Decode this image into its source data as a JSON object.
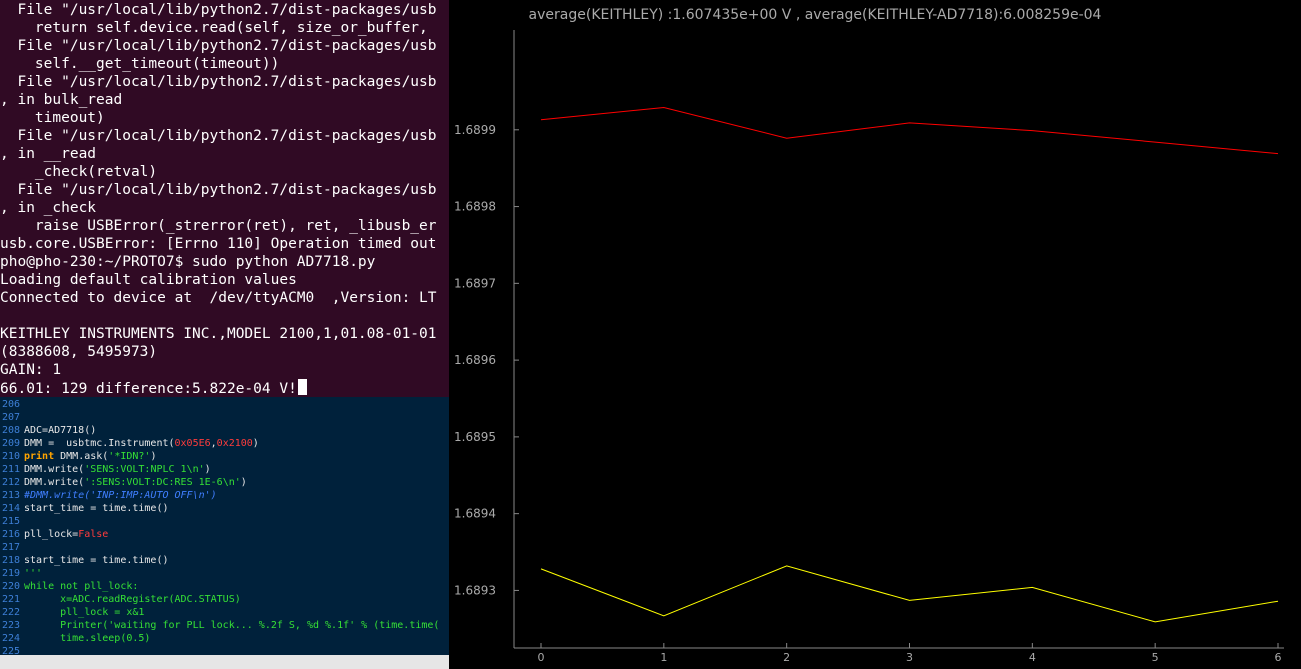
{
  "terminal": {
    "lines": [
      "  File \"/usr/local/lib/python2.7/dist-packages/usb",
      "    return self.device.read(self, size_or_buffer, ",
      "  File \"/usr/local/lib/python2.7/dist-packages/usb",
      "    self.__get_timeout(timeout))",
      "  File \"/usr/local/lib/python2.7/dist-packages/usb",
      ", in bulk_read",
      "    timeout)",
      "  File \"/usr/local/lib/python2.7/dist-packages/usb",
      ", in __read",
      "    _check(retval)",
      "  File \"/usr/local/lib/python2.7/dist-packages/usb",
      ", in _check",
      "    raise USBError(_strerror(ret), ret, _libusb_er",
      "usb.core.USBError: [Errno 110] Operation timed out",
      "pho@pho-230:~/PROTO7$ sudo python AD7718.py",
      "Loading default calibration values",
      "Connected to device at  /dev/ttyACM0  ,Version: LT",
      "",
      "KEITHLEY INSTRUMENTS INC.,MODEL 2100,1,01.08-01-01",
      "(8388608, 5495973)",
      "GAIN: 1",
      "66.01: 129 difference:5.822e-04 V!"
    ]
  },
  "editor": {
    "rows": [
      {
        "n": "206",
        "s": []
      },
      {
        "n": "207",
        "s": []
      },
      {
        "n": "208",
        "s": [
          {
            "t": "ADC=AD7718()",
            "c": ""
          }
        ]
      },
      {
        "n": "209",
        "s": [
          {
            "t": "DMM =  usbtmc.Instrument(",
            "c": ""
          },
          {
            "t": "0x05E6",
            "c": "num"
          },
          {
            "t": ",",
            "c": ""
          },
          {
            "t": "0x2100",
            "c": "num"
          },
          {
            "t": ")",
            "c": ""
          }
        ]
      },
      {
        "n": "210",
        "s": [
          {
            "t": "print",
            "c": "kw"
          },
          {
            "t": " DMM.ask(",
            "c": ""
          },
          {
            "t": "'*IDN?'",
            "c": "str"
          },
          {
            "t": ")",
            "c": ""
          }
        ]
      },
      {
        "n": "211",
        "s": [
          {
            "t": "DMM.write(",
            "c": ""
          },
          {
            "t": "'SENS:VOLT:NPLC 1\\n'",
            "c": "str"
          },
          {
            "t": ")",
            "c": ""
          }
        ]
      },
      {
        "n": "212",
        "s": [
          {
            "t": "DMM.write(",
            "c": ""
          },
          {
            "t": "':SENS:VOLT:DC:RES 1E-6\\n'",
            "c": "str"
          },
          {
            "t": ")",
            "c": ""
          }
        ]
      },
      {
        "n": "213",
        "s": [
          {
            "t": "#DMM.write('INP:IMP:AUTO OFF\\n')",
            "c": "cm"
          }
        ]
      },
      {
        "n": "214",
        "s": [
          {
            "t": "start_time = time.time()",
            "c": ""
          }
        ]
      },
      {
        "n": "215",
        "s": []
      },
      {
        "n": "216",
        "s": [
          {
            "t": "pll_lock=",
            "c": ""
          },
          {
            "t": "False",
            "c": "num"
          }
        ]
      },
      {
        "n": "217",
        "s": []
      },
      {
        "n": "218",
        "s": [
          {
            "t": "start_time = time.time()",
            "c": ""
          }
        ]
      },
      {
        "n": "219",
        "s": [
          {
            "t": "'''",
            "c": "grn"
          }
        ]
      },
      {
        "n": "220",
        "s": [
          {
            "t": "while not pll_lock:",
            "c": "grn"
          }
        ]
      },
      {
        "n": "221",
        "s": [
          {
            "t": "      x=ADC.readRegister(ADC.STATUS)",
            "c": "grn"
          }
        ]
      },
      {
        "n": "222",
        "s": [
          {
            "t": "      pll_lock = x&1",
            "c": "grn"
          }
        ]
      },
      {
        "n": "223",
        "s": [
          {
            "t": "      Printer('waiting for PLL lock... %.2f S, %d %.1f' % (time.time(",
            "c": "grn"
          }
        ]
      },
      {
        "n": "224",
        "s": [
          {
            "t": "      time.sleep(0.5)",
            "c": "grn"
          }
        ]
      },
      {
        "n": "225",
        "s": []
      }
    ]
  },
  "chart_data": {
    "type": "line",
    "title": "average(KEITHLEY) :1.607435e+00 V , average(KEITHLEY-AD7718):6.008259e-04",
    "x": [
      0,
      1,
      2,
      3,
      4,
      5,
      6
    ],
    "series": [
      {
        "color": "#ff0000",
        "values": [
          1.689913,
          1.689929,
          1.689889,
          1.689909,
          1.689899,
          1.689884,
          1.689869
        ]
      },
      {
        "color": "#ffff00",
        "values": [
          1.689328,
          1.689267,
          1.689332,
          1.689287,
          1.689304,
          1.689259,
          1.689286
        ]
      }
    ],
    "y_ticks": [
      "1.6899",
      "1.6898",
      "1.6897",
      "1.6896",
      "1.6895",
      "1.6894",
      "1.6893"
    ],
    "x_ticks": [
      "0",
      "1",
      "2",
      "3",
      "4",
      "5",
      "6"
    ],
    "xlim": [
      0,
      6
    ],
    "ylim": [
      1.689225,
      1.69003
    ],
    "grid": false,
    "colors": {
      "axis": "#888888",
      "text": "#aaaaaa",
      "background": "#000000"
    }
  }
}
